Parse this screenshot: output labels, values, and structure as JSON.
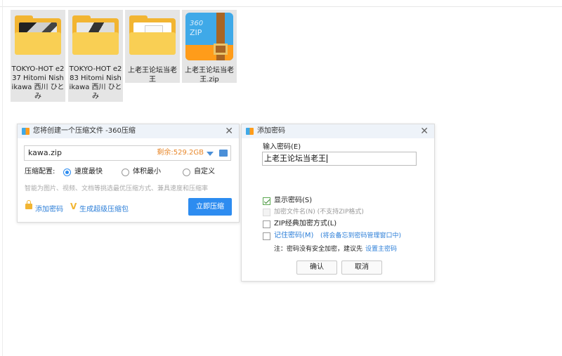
{
  "files": [
    {
      "label": "TOKYO-HOT e237 Hitomi Nishikawa 西川 ひとみ",
      "icon": "folder-with-photo-icon"
    },
    {
      "label": "TOKYO-HOT e283 Hitomi Nishikawa 西川 ひとみ",
      "icon": "folder-with-photo-icon"
    },
    {
      "label": "上老王论坛当老王",
      "icon": "folder-icon"
    },
    {
      "label": "上老王论坛当老王.zip",
      "icon": "zip-archive-icon"
    }
  ],
  "zip_icon": {
    "line1": "360",
    "line2": "ZIP"
  },
  "compress_dialog": {
    "title": "您将创建一个压缩文件 -360压缩",
    "close": "✕",
    "filename": "kawa.zip",
    "remaining": "剩余:529.2GB",
    "config_label": "压缩配置:",
    "options": [
      "速度最快",
      "体积最小",
      "自定义"
    ],
    "selected_option": 0,
    "hint": "智能为图片、视频、文档等挑选最优压缩方式、兼具速度和压缩率",
    "add_password": "添加密码",
    "make_super": "生成超级压缩包",
    "compress_now": "立即压缩",
    "accent": "#2d8cf0"
  },
  "password_dialog": {
    "title": "添加密码",
    "close": "✕",
    "input_label": "输入密码(E)",
    "password_value": "上老王论坛当老王",
    "show_password": "显示密码(S)",
    "show_password_checked": true,
    "encrypt_filenames": "加密文件名(N) (不支持ZIP格式)",
    "zip_classic": "ZIP经典加密方式(L)",
    "remember_password": "记住密码(M)",
    "remember_note": "(将会备忘到密码管理窗口中)",
    "note_prefix": "注：密码没有安全加密，建议先",
    "note_link": "设置主密码",
    "ok": "确认",
    "cancel": "取消"
  }
}
